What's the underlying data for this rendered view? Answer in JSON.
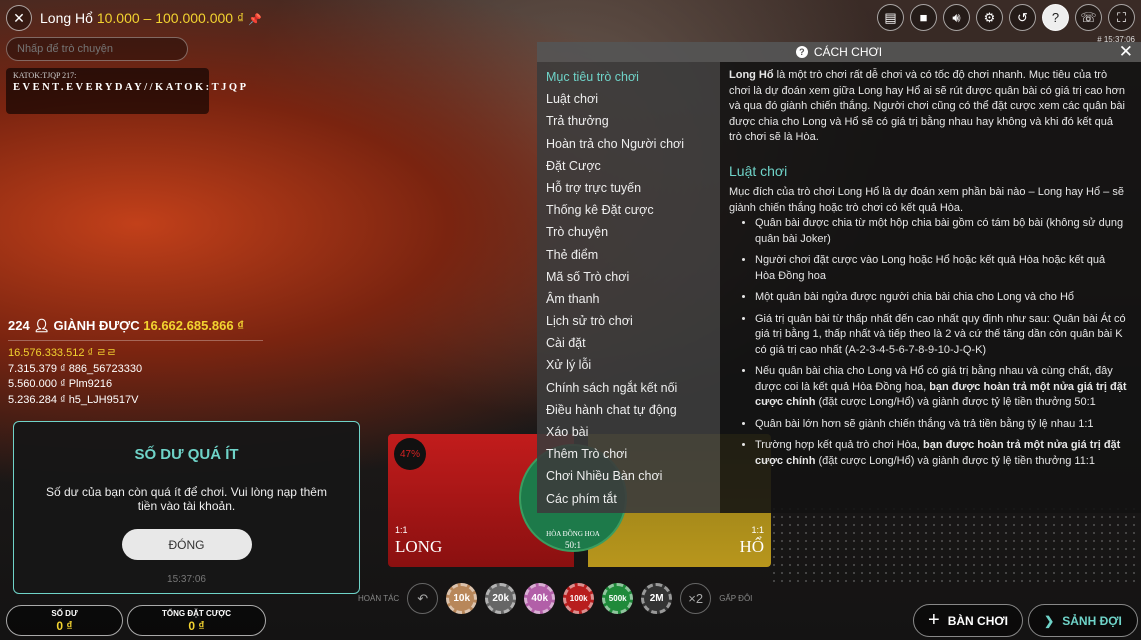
{
  "header": {
    "title": "Long Hổ",
    "limits": "10.000 – 100.000.000 ₫",
    "clock": "# 15:37:06"
  },
  "chat": {
    "placeholder": "Nhấp để trò chuyện",
    "message_user": "KATOK:TJQP 217:",
    "message_text": "EVENT.EVERYDAY//KATOK:TJQP"
  },
  "toolbar": [
    "chat-icon",
    "video-icon",
    "volume-icon",
    "gear-icon",
    "history-icon",
    "help-icon",
    "support-icon",
    "fullscreen-icon"
  ],
  "winners": {
    "count": "224",
    "label": "GIÀNH ĐƯỢC",
    "amount": "16.662.685.866 ₫",
    "list": [
      "16.576.333.512 ₫ ㄹㄹ",
      "7.315.379 ₫ 886_56723330",
      "5.560.000 ₫ Plm9216",
      "5.236.284 ₫ h5_LJH9517V"
    ]
  },
  "modal": {
    "title": "SỐ DƯ QUÁ ÍT",
    "message": "Số dư của bạn còn quá ít để chơi. Vui lòng nạp thêm tiền vào tài khoản.",
    "button": "ĐÓNG",
    "time": "15:37:06"
  },
  "balance": {
    "label": "SỐ DƯ",
    "value": "0 ₫"
  },
  "total_bet": {
    "label": "TỔNG ĐẶT CƯỢC",
    "value": "0 ₫"
  },
  "bets": {
    "long": {
      "name": "LONG",
      "odds": "1:1",
      "percent": "47%"
    },
    "tie": {
      "name": "HÒA ĐỒNG HOA",
      "odds": "50:1"
    },
    "ho": {
      "name": "HỔ",
      "odds": "1:1"
    }
  },
  "chips": {
    "undo": "HOÀN TÁC",
    "double": "GẤP ĐÔI",
    "double_symbol": "×2",
    "values": [
      {
        "label": "10k",
        "color": "#b8875a"
      },
      {
        "label": "20k",
        "color": "#666666"
      },
      {
        "label": "40k",
        "color": "#b25fa8"
      },
      {
        "label": "100k",
        "color": "#b81e1e"
      },
      {
        "label": "500k",
        "color": "#1f8a3a"
      },
      {
        "label": "2M",
        "color": "#333333"
      }
    ]
  },
  "buttons": {
    "tables": "BÀN CHƠI",
    "lobby": "SẢNH ĐỢI"
  },
  "help": {
    "title": "CÁCH CHƠI",
    "menu": [
      "Mục tiêu trò chơi",
      "Luật chơi",
      "Trả thưởng",
      "Hoàn trả cho Người chơi",
      "Đặt Cược",
      "Hỗ trợ trực tuyến",
      "Thống kê Đặt cược",
      "Trò chuyện",
      "Thẻ điểm",
      "Mã số Trò chơi",
      "Âm thanh",
      "Lịch sử trò chơi",
      "Cài đặt",
      "Xử lý lỗi",
      "Chính sách ngắt kết nối",
      "Điều hành chat tự động",
      "Xáo bài",
      "Thêm Trò chơi",
      "Chơi Nhiều Bàn chơi",
      "Các phím tắt"
    ],
    "intro_bold": "Long Hổ",
    "intro": " là một trò chơi rất dễ chơi và có tốc độ chơi nhanh. Mục tiêu của trò chơi là dự đoán xem giữa Long hay Hổ ai sẽ rút được quân bài có giá trị cao hơn và qua đó giành chiến thắng. Người chơi cũng có thể đặt cược xem các quân bài được chia cho Long và Hổ sẽ có giá trị bằng nhau hay không và khi đó kết quả trò chơi sẽ là Hòa.",
    "rules_title": "Luật chơi",
    "rules_intro": "Mục đích của trò chơi Long Hổ là dự đoán xem phần bài nào – Long hay Hổ – sẽ giành chiến thắng hoặc trò chơi có kết quả Hòa.",
    "rules": [
      "Quân bài được chia từ một hộp chia bài gồm có tám bộ bài (không sử dụng quân bài Joker)",
      "Người chơi đặt cược vào Long hoặc Hổ hoặc kết quả Hòa hoặc kết quả Hòa Đồng hoa",
      "Một quân bài ngửa được người chia bài chia cho Long và cho Hổ",
      "Giá trị quân bài từ thấp nhất đến cao nhất quy định như sau: Quân bài Át có giá trị bằng 1, thấp nhất và tiếp theo là 2 và cứ thế tăng dần còn quân bài K có giá trị cao nhất (A-2-3-4-5-6-7-8-9-10-J-Q-K)"
    ],
    "rule5a": "Nếu quân bài chia cho Long và Hổ có giá trị bằng nhau và cùng chất, đây được coi là kết quả Hòa Đồng hoa, ",
    "rule5b": "bạn được hoàn trả một nửa giá trị đặt cược chính",
    "rule5c": " (đặt cược Long/Hổ) và giành được tỷ lệ tiền thưởng 50:1",
    "rule6": "Quân bài lớn hơn sẽ giành chiến thắng và trả tiền bằng tỷ lệ nhau 1:1",
    "rule7a": "Trường hợp kết quả trò chơi Hòa, ",
    "rule7b": "bạn được hoàn trả một nửa giá trị đặt cược chính",
    "rule7c": " (đặt cược Long/Hổ) và giành được tỷ lệ tiền thưởng 11:1"
  }
}
